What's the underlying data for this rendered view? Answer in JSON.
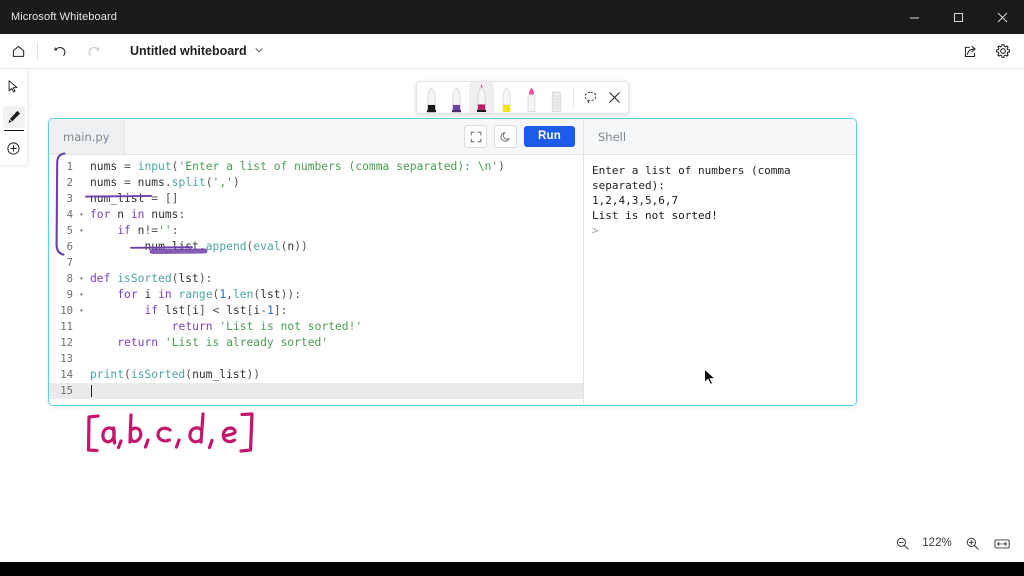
{
  "window": {
    "title": "Microsoft Whiteboard",
    "controls": [
      {
        "name": "minimize-button",
        "glyph": "minimize-icon"
      },
      {
        "name": "maximize-button",
        "glyph": "maximize-icon"
      },
      {
        "name": "close-button",
        "glyph": "close-icon"
      }
    ]
  },
  "commandbar": {
    "home_icon": "home-icon",
    "undo_icon": "undo-icon",
    "redo_icon": "redo-icon",
    "document_title": "Untitled whiteboard",
    "title_caret": "chevron-down-icon",
    "share_icon": "share-icon",
    "settings_icon": "gear-icon"
  },
  "tool_rail": {
    "items": [
      {
        "name": "select-tool",
        "icon": "cursor-arrow-icon",
        "active": false
      },
      {
        "name": "pen-tool",
        "icon": "pen-icon",
        "active": true
      },
      {
        "name": "add-tool",
        "icon": "plus-circle-icon",
        "active": false
      }
    ]
  },
  "pen_toolbar": {
    "pens": [
      {
        "name": "pen-black",
        "color": "#1a1a1a",
        "selected": false
      },
      {
        "name": "pen-purple",
        "color": "#6f3fa8",
        "selected": false
      },
      {
        "name": "pen-magenta",
        "color": "#c2186b",
        "selected": true
      },
      {
        "name": "pen-yellow",
        "color": "#f2e21a",
        "selected": false
      },
      {
        "name": "pen-pink",
        "color": "#ef4c9b",
        "selected": false
      },
      {
        "name": "eraser",
        "color": "#d8d8d8",
        "selected": false
      }
    ],
    "lasso_icon": "lasso-select-icon",
    "close_icon": "close-icon"
  },
  "replit": {
    "file_tab": "main.py",
    "fullscreen_icon": "fullscreen-icon",
    "theme_icon": "moon-icon",
    "run_label": "Run",
    "shell_label": "Shell",
    "shell_output": "Enter a list of numbers (comma separated):\n1,2,4,3,5,6,7\nList is not sorted!",
    "shell_prompt": ">",
    "code_lines": [
      {
        "n": "1",
        "fold": "",
        "text": "nums = input('Enter a list of numbers (comma separated): \\n')"
      },
      {
        "n": "2",
        "fold": "",
        "text": "nums = nums.split(',')"
      },
      {
        "n": "3",
        "fold": "",
        "text": "num_list = []"
      },
      {
        "n": "4",
        "fold": "▾",
        "text": "for n in nums:"
      },
      {
        "n": "5",
        "fold": "▾",
        "text": "    if n!='':"
      },
      {
        "n": "6",
        "fold": "",
        "text": "        num_list.append(eval(n))"
      },
      {
        "n": "7",
        "fold": "",
        "text": ""
      },
      {
        "n": "8",
        "fold": "▾",
        "text": "def isSorted(lst):"
      },
      {
        "n": "9",
        "fold": "▾",
        "text": "    for i in range(1,len(lst)):"
      },
      {
        "n": "10",
        "fold": "▾",
        "text": "        if lst[i] < lst[i-1]:"
      },
      {
        "n": "11",
        "fold": "",
        "text": "            return 'List is not sorted!'"
      },
      {
        "n": "12",
        "fold": "",
        "text": "    return 'List is already sorted'"
      },
      {
        "n": "13",
        "fold": "",
        "text": ""
      },
      {
        "n": "14",
        "fold": "",
        "text": "print(isSorted(num_list))"
      },
      {
        "n": "15",
        "fold": "",
        "text": ""
      }
    ]
  },
  "ink_annotations": {
    "handwriting_text": "[a, b, c, d, e]",
    "handwriting_color": "#c2186b",
    "bracket_color": "#6f3fa8",
    "underline_color": "#6f3fa8"
  },
  "zoom_controls": {
    "zoom_out_icon": "zoom-out-icon",
    "level": "122%",
    "zoom_in_icon": "zoom-in-icon",
    "fit_icon": "fit-to-screen-icon"
  },
  "colors": {
    "accent_run": "#1d5ce8",
    "embed_border": "#57d0ec",
    "titlebar_bg": "#1b1b1b"
  }
}
